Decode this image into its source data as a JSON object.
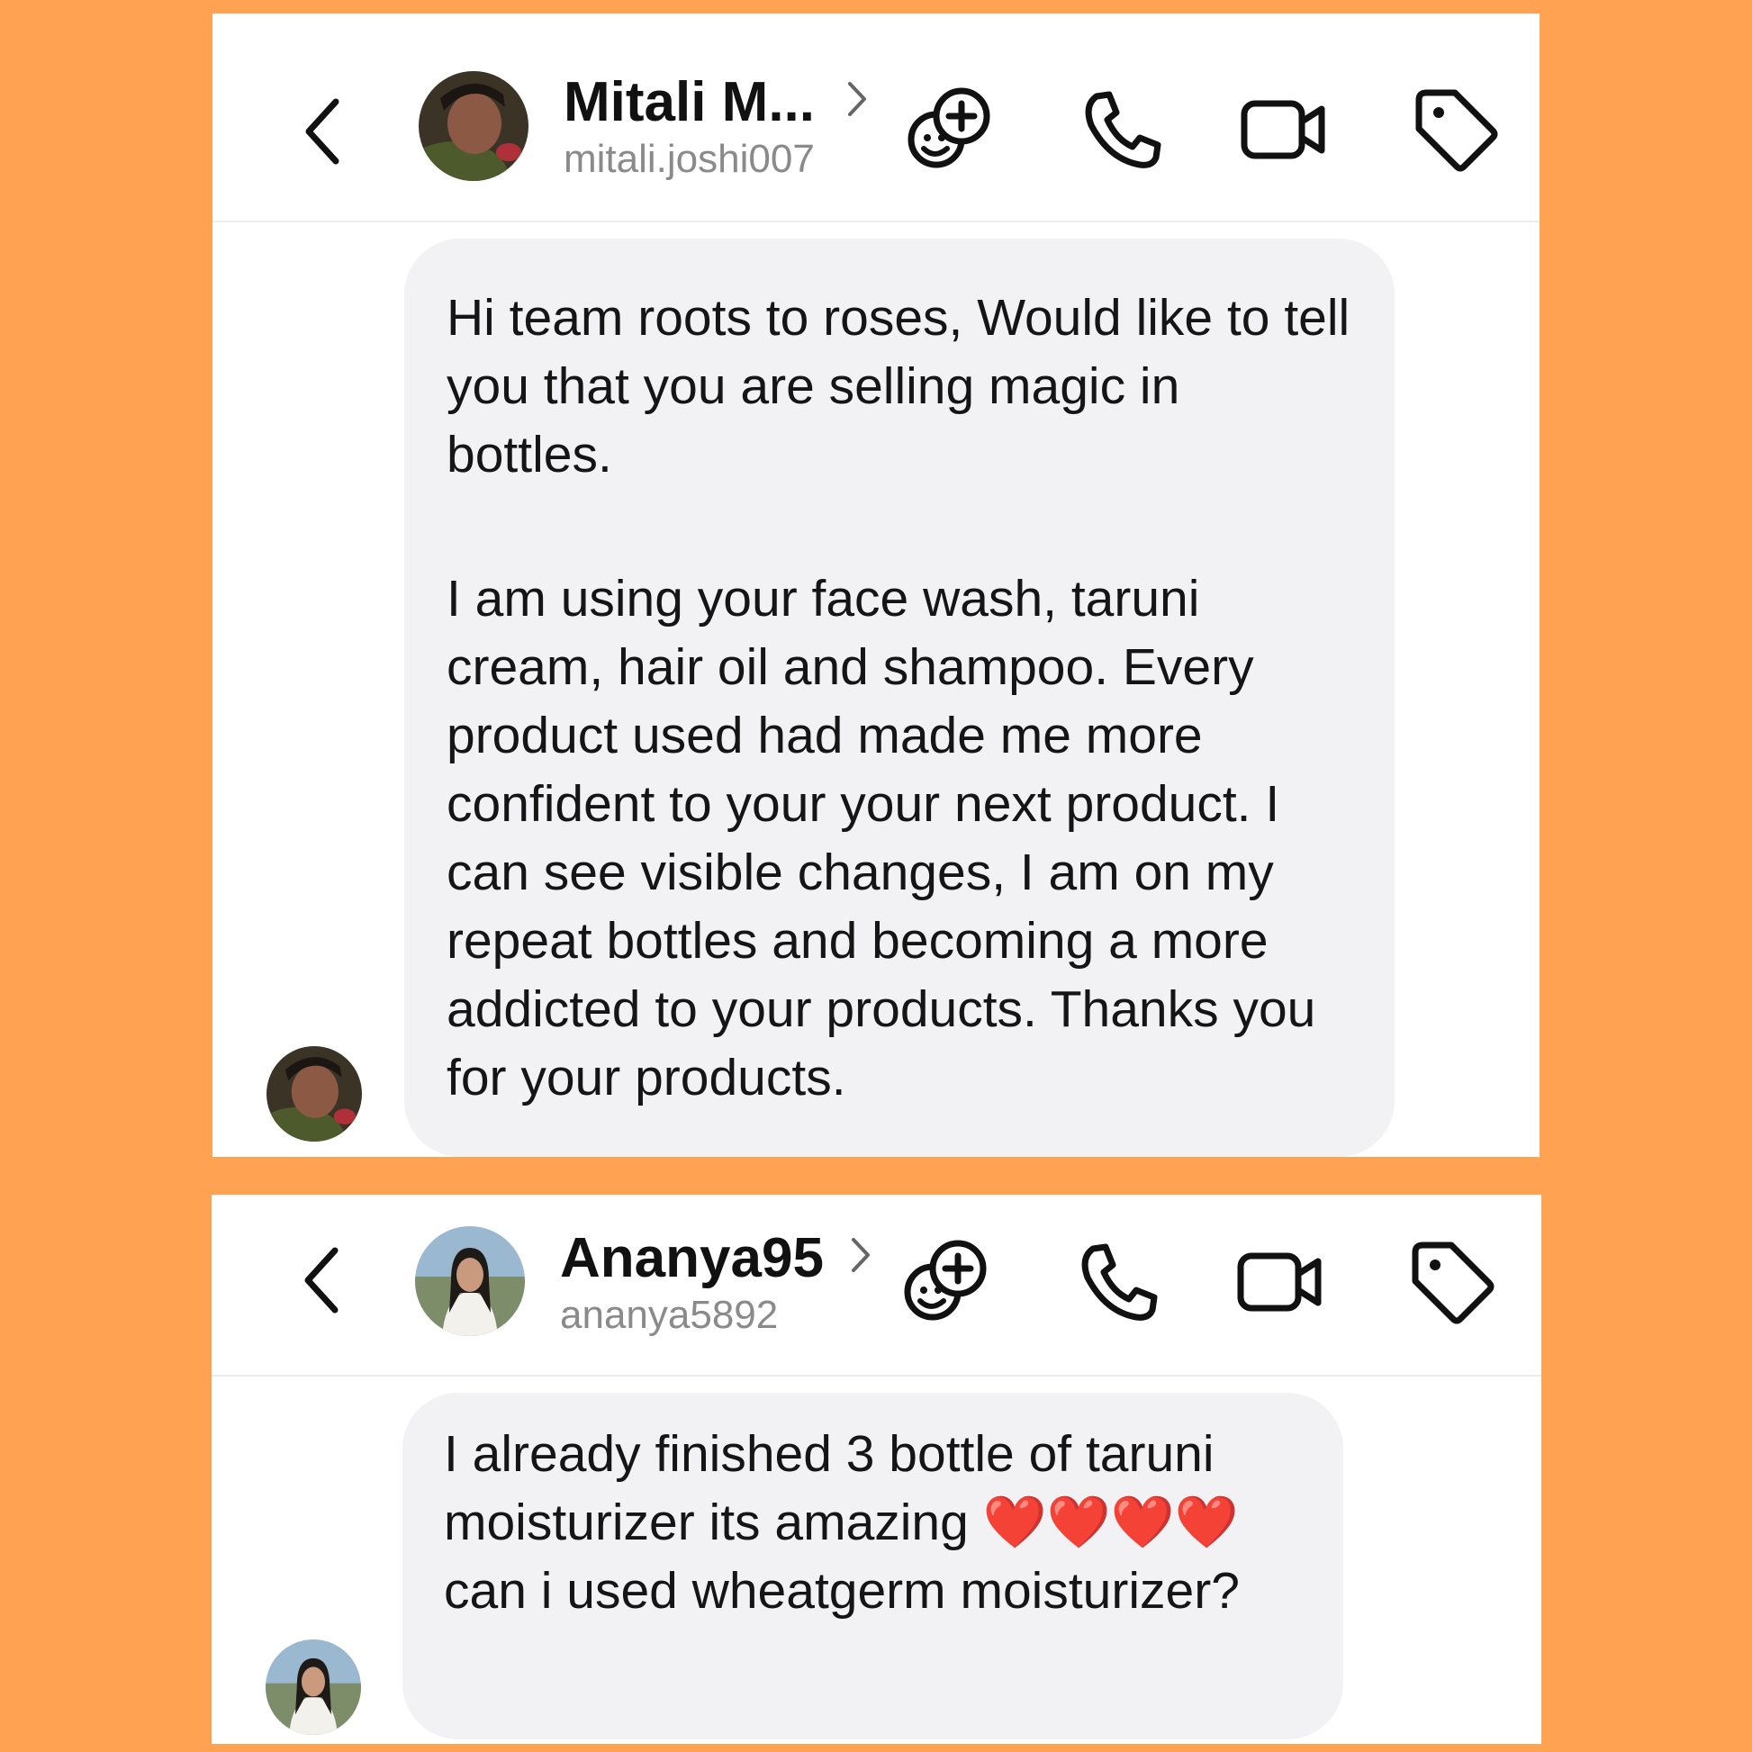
{
  "colors": {
    "background": "#ffa352",
    "bubble": "#f2f2f4",
    "heart": "#e8141b"
  },
  "conversations": [
    {
      "contact": {
        "name": "Mitali M...",
        "handle": "mitali.joshi007"
      },
      "icons": [
        "back-icon",
        "sticker-add-icon",
        "phone-icon",
        "video-icon",
        "tag-icon"
      ],
      "message": {
        "paragraph1": "Hi team roots to roses, Would like to tell you that you are selling magic in bottles.",
        "paragraph2": "I am using your face wash, taruni cream, hair oil and shampoo. Every product used had made me more confident to your your next product. I can see visible changes, I am on my repeat bottles and becoming a more addicted to your products. Thanks you for your products."
      }
    },
    {
      "contact": {
        "name": "Ananya95",
        "handle": "ananya5892"
      },
      "icons": [
        "back-icon",
        "sticker-add-icon",
        "phone-icon",
        "video-icon",
        "tag-icon"
      ],
      "message": {
        "text_before": "I already finished 3 bottle of taruni moisturizer its amazing ",
        "hearts": "❤️❤️❤️❤️",
        "text_after": " can i used wheatgerm moisturizer?"
      }
    }
  ]
}
